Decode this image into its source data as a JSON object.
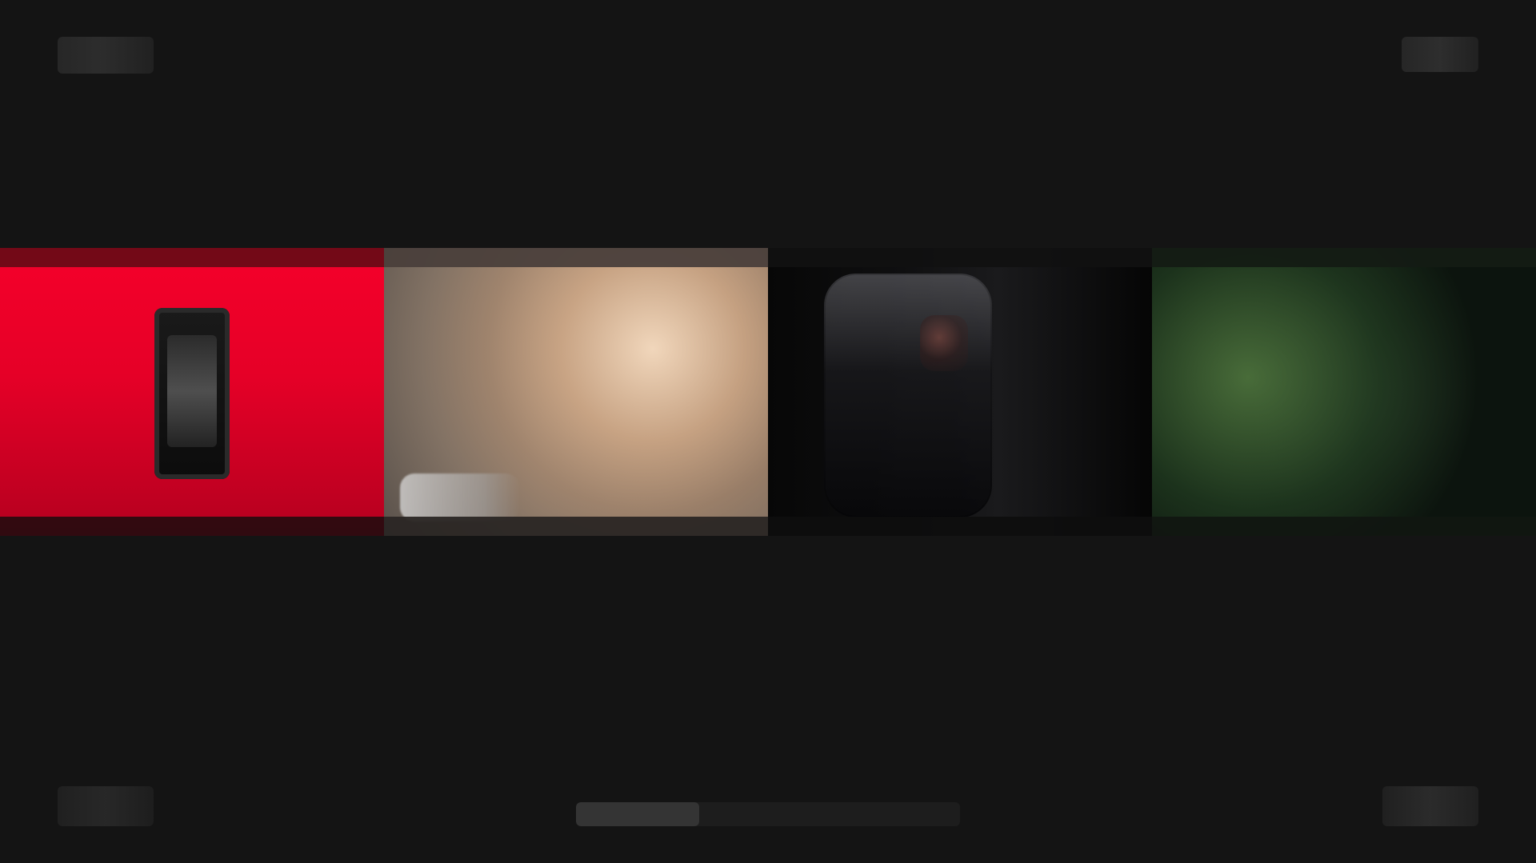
{
  "carousel": {
    "items": [
      {
        "title": "",
        "meta": ""
      },
      {
        "title": "",
        "meta": ""
      },
      {
        "title": "",
        "meta": ""
      },
      {
        "title": "",
        "meta": ""
      }
    ]
  },
  "playback": {
    "progress": 0.32
  },
  "colors": {
    "background": "#141414",
    "card1_primary": "#e50027"
  },
  "icons": {
    "top_left": "menu-icon",
    "top_right": "profile-icon",
    "bottom_left": "pause-icon",
    "bottom_right": "settings-icon"
  }
}
